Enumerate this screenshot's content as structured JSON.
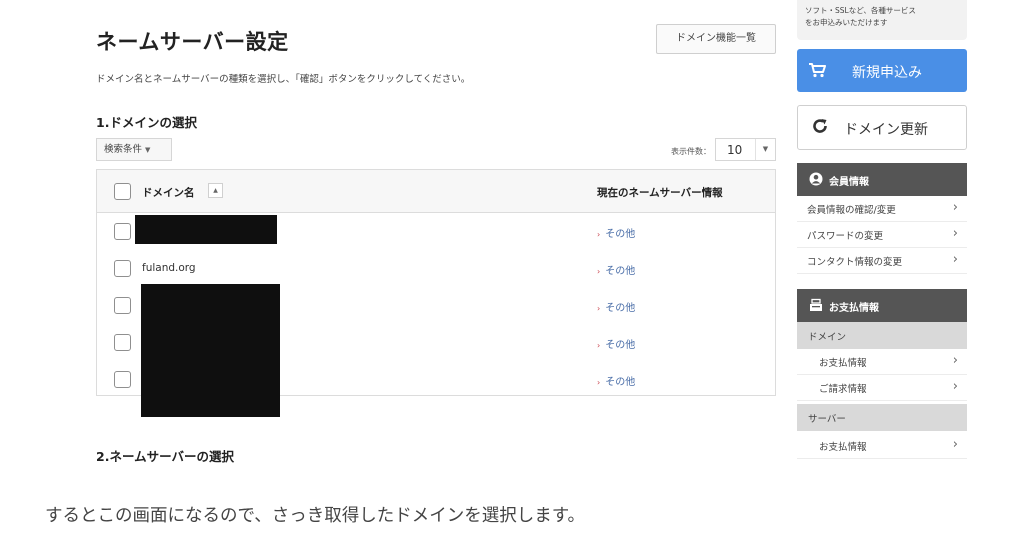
{
  "main": {
    "title": "ネームサーバー設定",
    "feature_list_button": "ドメイン機能一覧",
    "description": "ドメイン名とネームサーバーの種類を選択し、「確認」ボタンをクリックしてください。",
    "section1_title": "1.ドメインの選択",
    "search_conditions_label": "検索条件",
    "per_page_label": "表示件数：",
    "per_page_value": "10",
    "table": {
      "header_domain": "ドメイン名",
      "header_nameserver": "現在のネームサーバー情報",
      "rows": [
        {
          "domain": "",
          "nameserver": "その他",
          "redacted": true
        },
        {
          "domain": "fuland.org",
          "nameserver": "その他",
          "redacted": false
        },
        {
          "domain": "",
          "nameserver": "その他",
          "redacted": true
        },
        {
          "domain": "",
          "nameserver": "その他",
          "redacted": true
        },
        {
          "domain": "",
          "nameserver": "その他",
          "redacted": true
        }
      ]
    },
    "section2_title": "2.ネームサーバーの選択"
  },
  "sidebar": {
    "promo_text_line1": "ソフト・SSLなど、各種サービス",
    "promo_text_line2": "をお申込みいただけます",
    "new_apply_label": "新規申込み",
    "renew_label": "ドメイン更新",
    "member_panel": {
      "title": "会員情報",
      "items": [
        "会員情報の確認/変更",
        "パスワードの変更",
        "コンタクト情報の変更"
      ]
    },
    "payment_panel": {
      "title": "お支払情報",
      "category_domain": "ドメイン",
      "domain_items": [
        "お支払情報",
        "ご請求情報"
      ],
      "category_server": "サーバー",
      "server_items": [
        "お支払情報"
      ]
    }
  },
  "caption": "するとこの画面になるので、さっき取得したドメインを選択します。",
  "colors": {
    "accent_blue": "#4a8fe6",
    "panel_header": "#555555",
    "link_blue": "#4a6ea8",
    "arrow_red": "#c9424c",
    "redaction": "#0f0f0f"
  }
}
